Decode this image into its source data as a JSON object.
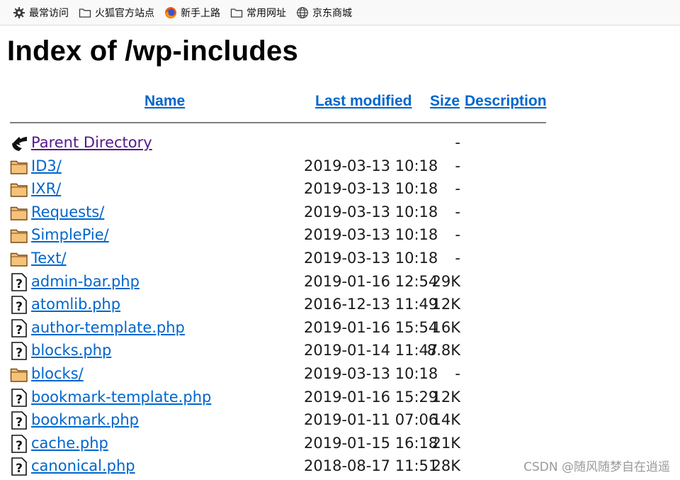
{
  "bookmarks": [
    {
      "label": "最常访问",
      "icon": "gear-icon"
    },
    {
      "label": "火狐官方站点",
      "icon": "folder-outline-icon"
    },
    {
      "label": "新手上路",
      "icon": "firefox-icon"
    },
    {
      "label": "常用网址",
      "icon": "folder-outline-icon"
    },
    {
      "label": "京东商城",
      "icon": "globe-icon"
    }
  ],
  "page": {
    "title": "Index of /wp-includes",
    "headers": {
      "name": "Name",
      "last_modified": "Last modified",
      "size": "Size",
      "description": "Description"
    }
  },
  "listing": [
    {
      "name": "Parent Directory",
      "modified": "",
      "size": "-",
      "type": "parent"
    },
    {
      "name": "ID3/",
      "modified": "2019-03-13 10:18",
      "size": "-",
      "type": "folder"
    },
    {
      "name": "IXR/",
      "modified": "2019-03-13 10:18",
      "size": "-",
      "type": "folder"
    },
    {
      "name": "Requests/",
      "modified": "2019-03-13 10:18",
      "size": "-",
      "type": "folder"
    },
    {
      "name": "SimplePie/",
      "modified": "2019-03-13 10:18",
      "size": "-",
      "type": "folder"
    },
    {
      "name": "Text/",
      "modified": "2019-03-13 10:18",
      "size": "-",
      "type": "folder"
    },
    {
      "name": "admin-bar.php",
      "modified": "2019-01-16 12:54",
      "size": "29K",
      "type": "file"
    },
    {
      "name": "atomlib.php",
      "modified": "2016-12-13 11:49",
      "size": "12K",
      "type": "file"
    },
    {
      "name": "author-template.php",
      "modified": "2019-01-16 15:54",
      "size": "16K",
      "type": "file"
    },
    {
      "name": "blocks.php",
      "modified": "2019-01-14 11:47",
      "size": "8.8K",
      "type": "file"
    },
    {
      "name": "blocks/",
      "modified": "2019-03-13 10:18",
      "size": "-",
      "type": "folder"
    },
    {
      "name": "bookmark-template.php",
      "modified": "2019-01-16 15:29",
      "size": "12K",
      "type": "file"
    },
    {
      "name": "bookmark.php",
      "modified": "2019-01-11 07:06",
      "size": "14K",
      "type": "file"
    },
    {
      "name": "cache.php",
      "modified": "2019-01-15 16:18",
      "size": "21K",
      "type": "file"
    },
    {
      "name": "canonical.php",
      "modified": "2018-08-17 11:51",
      "size": "28K",
      "type": "file"
    }
  ],
  "watermark": "CSDN @随风随梦自在逍遥",
  "colors": {
    "link": "#0066cc",
    "visited_link": "#551a8b",
    "folder_fill": "#f5c27a",
    "folder_stroke": "#7a4a12"
  }
}
